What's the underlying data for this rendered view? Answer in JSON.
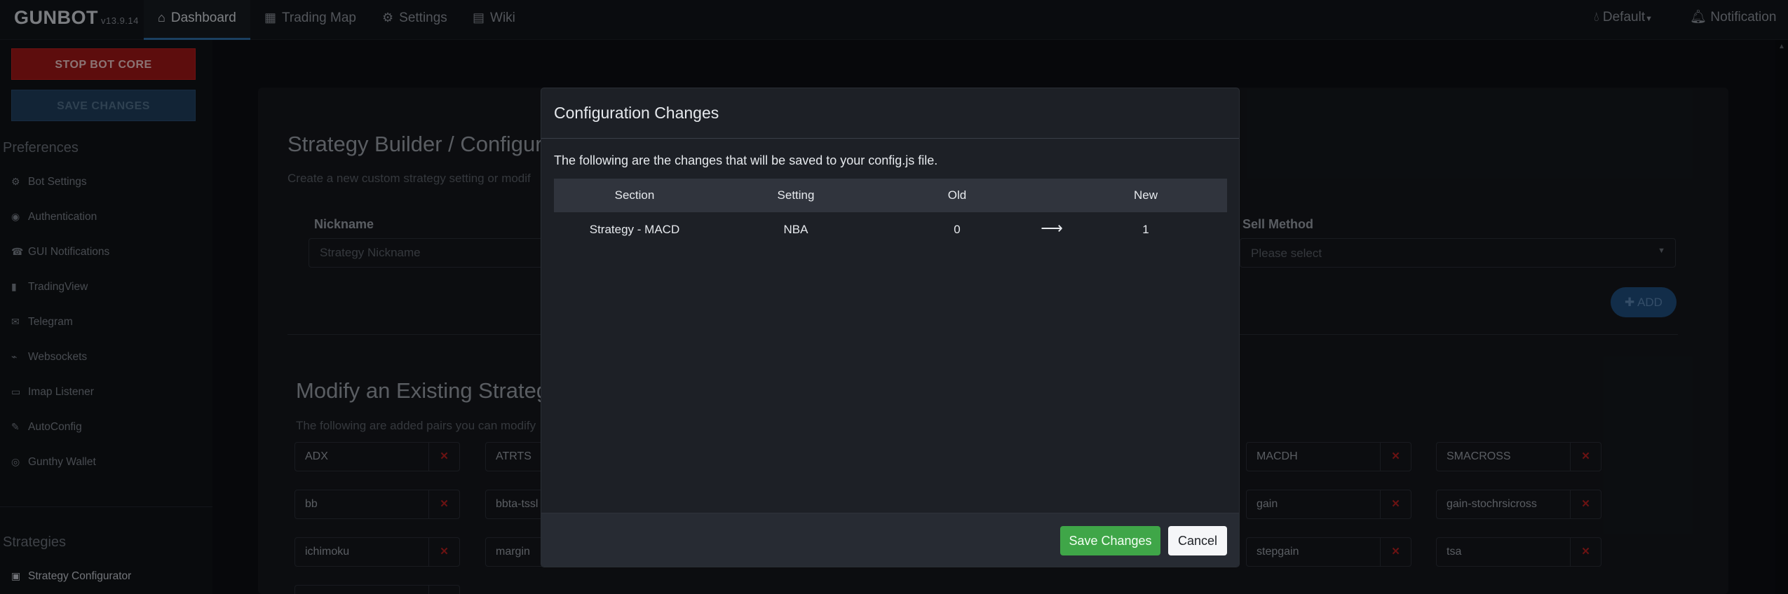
{
  "app": {
    "logo": "GUNBOT",
    "version": "v13.9.14"
  },
  "nav": {
    "dashboard": "Dashboard",
    "trading_map": "Trading Map",
    "settings": "Settings",
    "wiki": "Wiki",
    "default": "Default",
    "notification": "Notification"
  },
  "sidebar": {
    "stop_bot": "STOP BOT CORE",
    "save_changes": "SAVE CHANGES",
    "preferences_heading": "Preferences",
    "items": [
      {
        "label": "Bot Settings",
        "icon": "gear-icon"
      },
      {
        "label": "Authentication",
        "icon": "user-circle-icon"
      },
      {
        "label": "GUI Notifications",
        "icon": "bell-icon"
      },
      {
        "label": "TradingView",
        "icon": "bar-chart-icon"
      },
      {
        "label": "Telegram",
        "icon": "message-icon"
      },
      {
        "label": "Websockets",
        "icon": "plug-icon"
      },
      {
        "label": "Imap Listener",
        "icon": "monitor-icon"
      },
      {
        "label": "AutoConfig",
        "icon": "wrench-icon"
      },
      {
        "label": "Gunthy Wallet",
        "icon": "wallet-icon"
      }
    ],
    "strategies_heading": "Strategies",
    "strategy_configurator": "Strategy Configurator"
  },
  "main": {
    "builder_title": "Strategy Builder / Configura",
    "builder_subtitle": "Create a new custom strategy setting or modif",
    "nickname_label": "Nickname",
    "nickname_placeholder": "Strategy Nickname",
    "sell_method_label": "Sell Method",
    "sell_method_placeholder": "Please select",
    "add_button": "ADD",
    "modify_title": "Modify an Existing Strateg",
    "modify_subtitle": "The following are added pairs you can modify",
    "strategies": [
      "ADX",
      "ATRTS",
      "MACDH",
      "SMACROSS",
      "bb",
      "bbta-tssl",
      "gain",
      "gain-stochrsicross",
      "ichimoku",
      "margin",
      "stepgain",
      "tsa"
    ]
  },
  "modal": {
    "title": "Configuration Changes",
    "description": "The following are the changes that will be saved to your config.js file.",
    "columns": {
      "section": "Section",
      "setting": "Setting",
      "old": "Old",
      "new": "New"
    },
    "rows": [
      {
        "section": "Strategy - MACD",
        "setting": "NBA",
        "old": "0",
        "arrow": "⟶",
        "new": "1"
      }
    ],
    "save_button": "Save Changes",
    "cancel_button": "Cancel"
  },
  "colors": {
    "stop_button": "#a01717",
    "save_changes_button": "#3fa648",
    "accent": "#2f6ea8",
    "delete_x": "#b81f1f"
  }
}
